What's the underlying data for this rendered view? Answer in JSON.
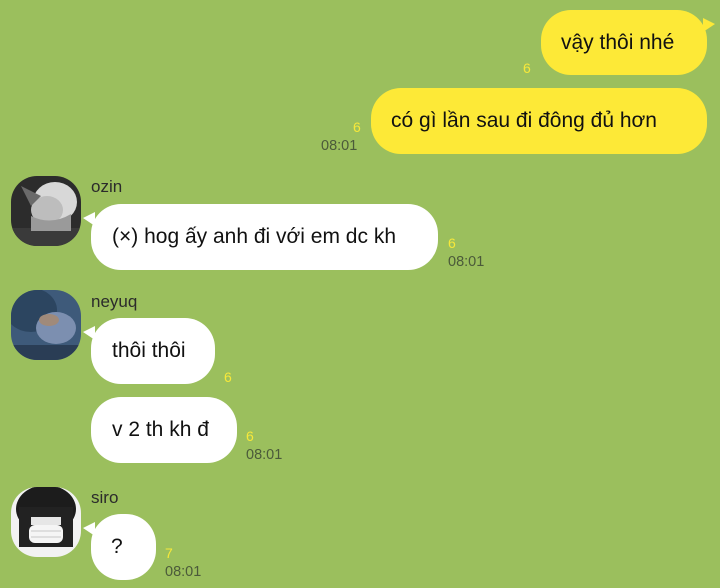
{
  "messages": [
    {
      "text": "vậy thôi nhé",
      "unread": "6"
    },
    {
      "text": "có gì lần sau đi đông đủ hơn",
      "unread": "6",
      "time": "08:01"
    },
    {
      "sender": "ozin",
      "text": "(×) hog ấy anh đi với em dc kh",
      "unread": "6",
      "time": "08:01"
    },
    {
      "sender": "neyuq",
      "text": "thôi thôi",
      "unread": "6"
    },
    {
      "text": "v 2 th kh đ",
      "unread": "6",
      "time": "08:01"
    },
    {
      "sender": "siro",
      "text": "?",
      "unread": "7",
      "time": "08:01"
    }
  ],
  "colors": {
    "background": "#9bbf5d",
    "outgoing_bubble": "#fde937",
    "incoming_bubble": "#ffffff",
    "unread_count": "#f7e83a"
  }
}
